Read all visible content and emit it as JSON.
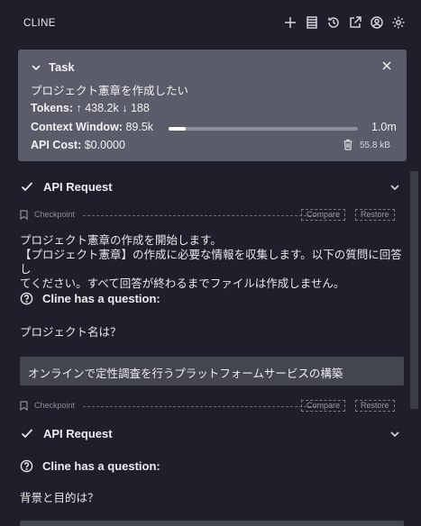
{
  "app": {
    "title": "CLINE"
  },
  "toolbar": {
    "icons": [
      "plus-icon",
      "history-list-icon",
      "history-icon",
      "popout-icon",
      "account-icon",
      "settings-icon"
    ]
  },
  "task": {
    "label": "Task",
    "description": "プロジェクト憲章を作成したい",
    "tokens_label": "Tokens:",
    "tokens_up": "↑ 438.2k",
    "tokens_down": "↓ 188",
    "context_label": "Context Window:",
    "context_used": "89.5k",
    "context_max": "1.0m",
    "context_fraction": 0.0895,
    "cost_label": "API Cost:",
    "cost_value": "$0.0000",
    "size": "55.8 kB"
  },
  "conversation": {
    "request1": "API Request",
    "checkpoint1": {
      "label": "Checkpoint",
      "compare": "Compare",
      "restore": "Restore"
    },
    "message1_line1": "プロジェクト憲章の作成を開始します。",
    "message1_line2": "【プロジェクト憲章】の作成に必要な情報を収集します。以下の質問に回答し",
    "message1_line3": "てください。すべて回答が終わるまでファイルは作成しません。",
    "question1_label": "Cline has a question:",
    "question1_text": "プロジェクト名は？",
    "answer1": "オンラインで定性調査を行うプラットフォームサービスの構築",
    "checkpoint2": {
      "label": "Checkpoint",
      "compare": "Compare",
      "restore": "Restore"
    },
    "request2": "API Request",
    "question2_label": "Cline has a question:",
    "question2_text": "背景と目的は？"
  }
}
